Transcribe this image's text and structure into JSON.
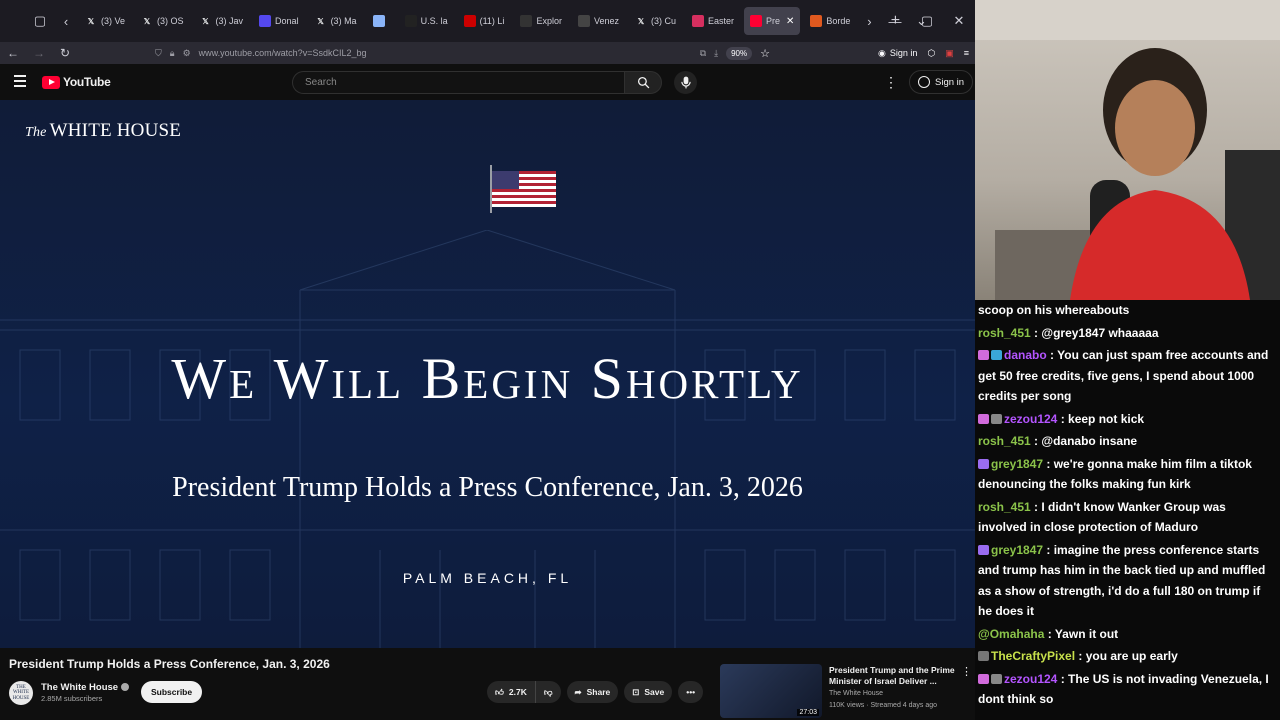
{
  "browser": {
    "tabs": [
      {
        "label": "(3) Ve",
        "icon": "x-icon",
        "color": "#e7e9ea"
      },
      {
        "label": "(3) OS",
        "icon": "x-icon",
        "color": "#e7e9ea"
      },
      {
        "label": "(3) Jav",
        "icon": "x-icon",
        "color": "#e7e9ea"
      },
      {
        "label": "Donal",
        "icon": "truth-icon",
        "color": "#5448ee"
      },
      {
        "label": "(3) Ma",
        "icon": "x-icon",
        "color": "#e7e9ea"
      },
      {
        "label": "",
        "icon": "app-icon",
        "color": "#8ab4f8"
      },
      {
        "label": "U.S. la",
        "icon": "nyt-icon",
        "color": "#222222"
      },
      {
        "label": "(11) Li",
        "icon": "cnn-icon",
        "color": "#cc0000"
      },
      {
        "label": "Explor",
        "icon": "wp-icon",
        "color": "#333333"
      },
      {
        "label": "Venez",
        "icon": "chat-icon",
        "color": "#444444"
      },
      {
        "label": "(3) Cu",
        "icon": "x-icon",
        "color": "#e7e9ea"
      },
      {
        "label": "Easter",
        "icon": "l-icon",
        "color": "#d62f5f"
      },
      {
        "label": "Pre",
        "icon": "youtube-icon",
        "color": "#ff0033",
        "active": true
      },
      {
        "label": "Borde",
        "icon": "globe-icon",
        "color": "#e0591f"
      }
    ],
    "url": "www.youtube.com/watch?v=SsdkCIL2_bg",
    "zoom": "90%",
    "signin_label": "Sign in"
  },
  "youtube": {
    "logo_text": "YouTube",
    "search_placeholder": "Search",
    "signin_label": "Sign in"
  },
  "player": {
    "wordmark_the": "The",
    "wordmark": "WHITE HOUSE",
    "headline": "We Will Begin Shortly",
    "subtitle": "President Trump Holds a Press Conference, Jan. 3, 2026",
    "location": "PALM BEACH, FL"
  },
  "video": {
    "title": "President Trump Holds a Press Conference, Jan. 3, 2026",
    "channel": "The White House",
    "subscribers": "2.85M subscribers",
    "subscribe_label": "Subscribe",
    "likes": "2.7K",
    "share_label": "Share",
    "save_label": "Save",
    "avatar_text": "THE WHITE HOUSE"
  },
  "recommendation": {
    "title": "President Trump and the Prime Minister of Israel Deliver ...",
    "channel": "The White House",
    "meta": "110K views · Streamed 4 days ago",
    "duration": "27:03"
  },
  "chat": [
    {
      "user": "",
      "text": "scoop on his whereabouts",
      "color": "#ffffff"
    },
    {
      "user": "rosh_451",
      "text": "@grey1847 whaaaaa",
      "color": "#8bc34a"
    },
    {
      "user": "danabo",
      "text": "You can just spam free accounts and get 50 free credits, five gens, I spend about 1000 credits per song",
      "color": "#b455ff",
      "badges": [
        "#d16bdc",
        "#3aa7d8"
      ]
    },
    {
      "user": "zezou124",
      "text": "keep not kick",
      "color": "#b455ff",
      "badges": [
        "#d16bdc",
        "#888888"
      ]
    },
    {
      "user": "rosh_451",
      "text": "@danabo insane",
      "color": "#8bc34a"
    },
    {
      "user": "grey1847",
      "text": "we're gonna make him film a tiktok denouncing the folks making fun kirk",
      "color": "#8bc34a",
      "badges": [
        "#9a6cf0"
      ]
    },
    {
      "user": "rosh_451",
      "text": "I didn't know Wanker Group was involved in close protection of Maduro",
      "color": "#8bc34a"
    },
    {
      "user": "grey1847",
      "text": "imagine the press conference starts and trump has him in the back tied up and muffled as a show of strength, i'd do a full 180 on trump if he does it",
      "color": "#8bc34a",
      "badges": [
        "#9a6cf0"
      ]
    },
    {
      "user": "@Omahaha",
      "text": "Yawn it out",
      "color": "#8bc34a"
    },
    {
      "user": "TheCraftyPixel",
      "text": "you are up early",
      "color": "#c7e04b",
      "badges": [
        "#777777"
      ]
    },
    {
      "user": "zezou124",
      "text": "The US is not invading Venezuela, I dont think so",
      "color": "#b455ff",
      "badges": [
        "#d16bdc",
        "#888888"
      ]
    }
  ]
}
